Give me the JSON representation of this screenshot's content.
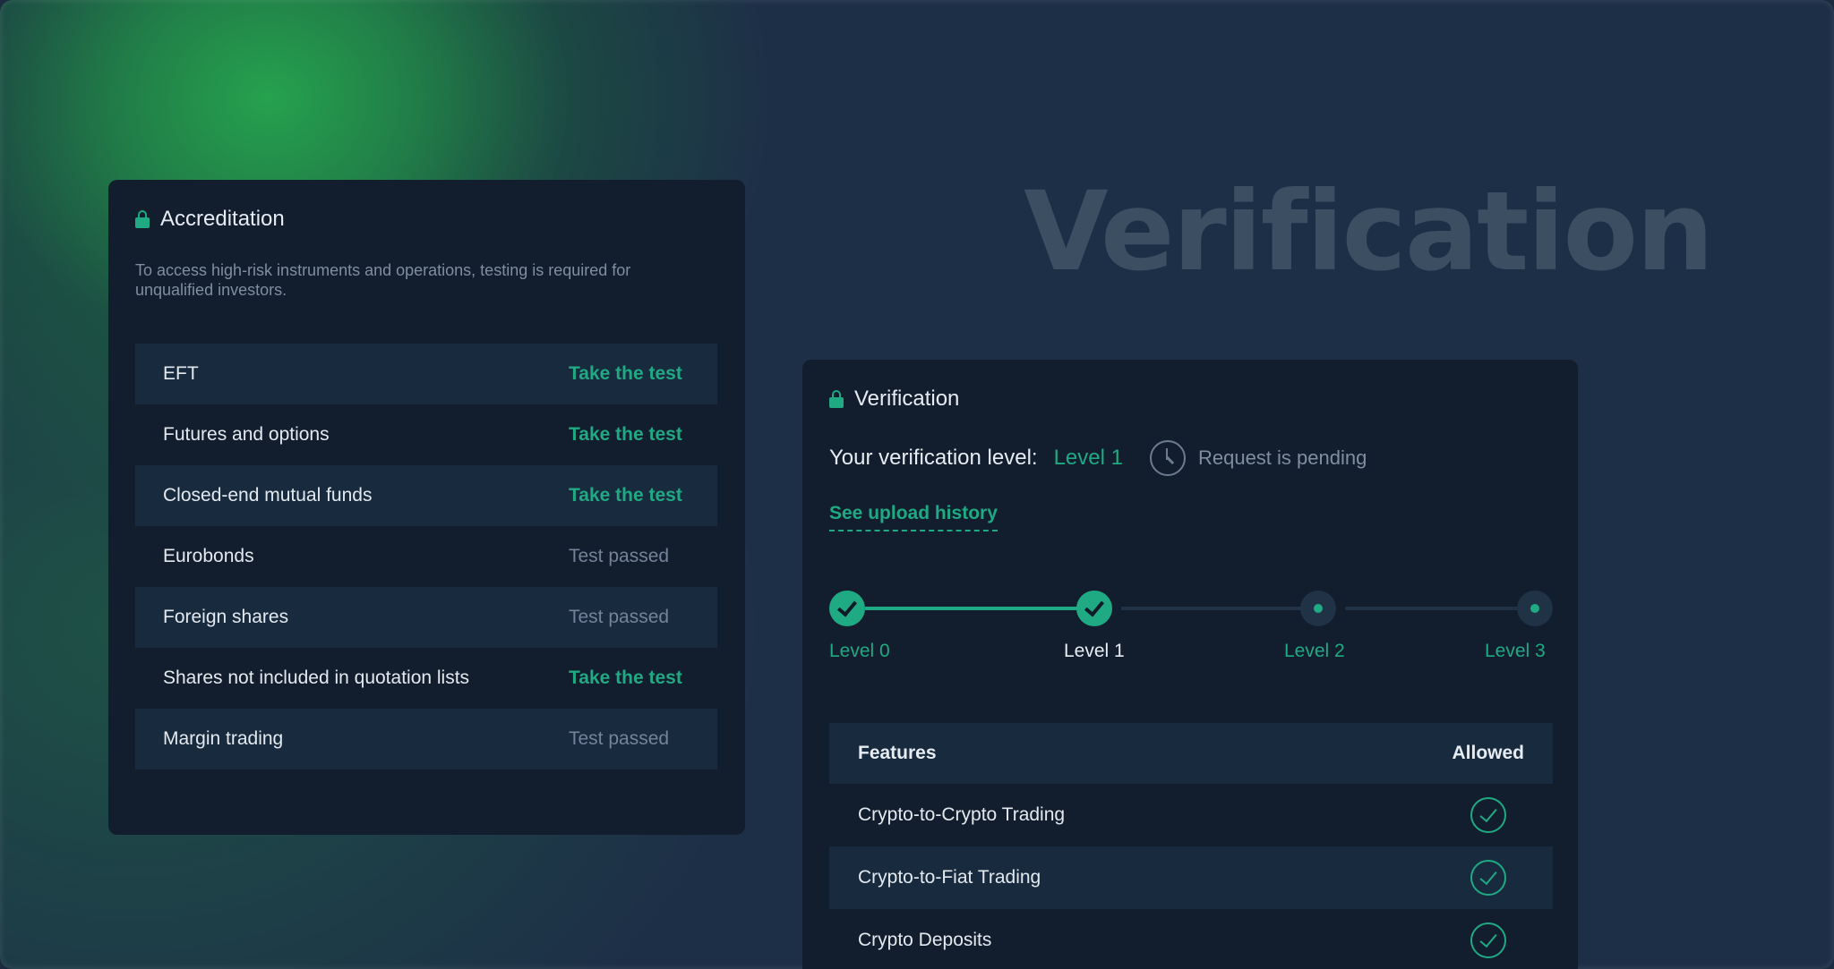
{
  "hero": {
    "title": "Verification"
  },
  "accreditation": {
    "title": "Accreditation",
    "description": "To access high-risk instruments and operations, testing is required for unqualified investors.",
    "items": [
      {
        "label": "EFT",
        "action": "Take the test"
      },
      {
        "label": "Futures and options",
        "action": "Take the test"
      },
      {
        "label": "Closed-end mutual funds",
        "action": "Take the test"
      },
      {
        "label": "Eurobonds",
        "action": "Test passed"
      },
      {
        "label": "Foreign shares",
        "action": "Test passed"
      },
      {
        "label": "Shares not included in quotation lists",
        "action": "Take the test"
      },
      {
        "label": "Margin trading",
        "action": "Test passed"
      }
    ]
  },
  "verification": {
    "title": "Verification",
    "level_label": "Your verification level:",
    "level_value": "Level 1",
    "status": "Request is pending",
    "upload_history": "See upload history",
    "steps": [
      {
        "label": "Level 0",
        "state": "done"
      },
      {
        "label": "Level 1",
        "state": "current"
      },
      {
        "label": "Level 2",
        "state": "todo"
      },
      {
        "label": "Level 3",
        "state": "todo"
      }
    ],
    "features_header": "Features",
    "allowed_header": "Allowed",
    "features": [
      {
        "name": "Crypto-to-Crypto Trading",
        "allowed": true
      },
      {
        "name": "Crypto-to-Fiat Trading",
        "allowed": true
      },
      {
        "name": "Crypto Deposits",
        "allowed": true
      }
    ]
  },
  "colors": {
    "accent": "#1faa83",
    "card": "#121d2d",
    "row_alt": "#182a3e"
  }
}
